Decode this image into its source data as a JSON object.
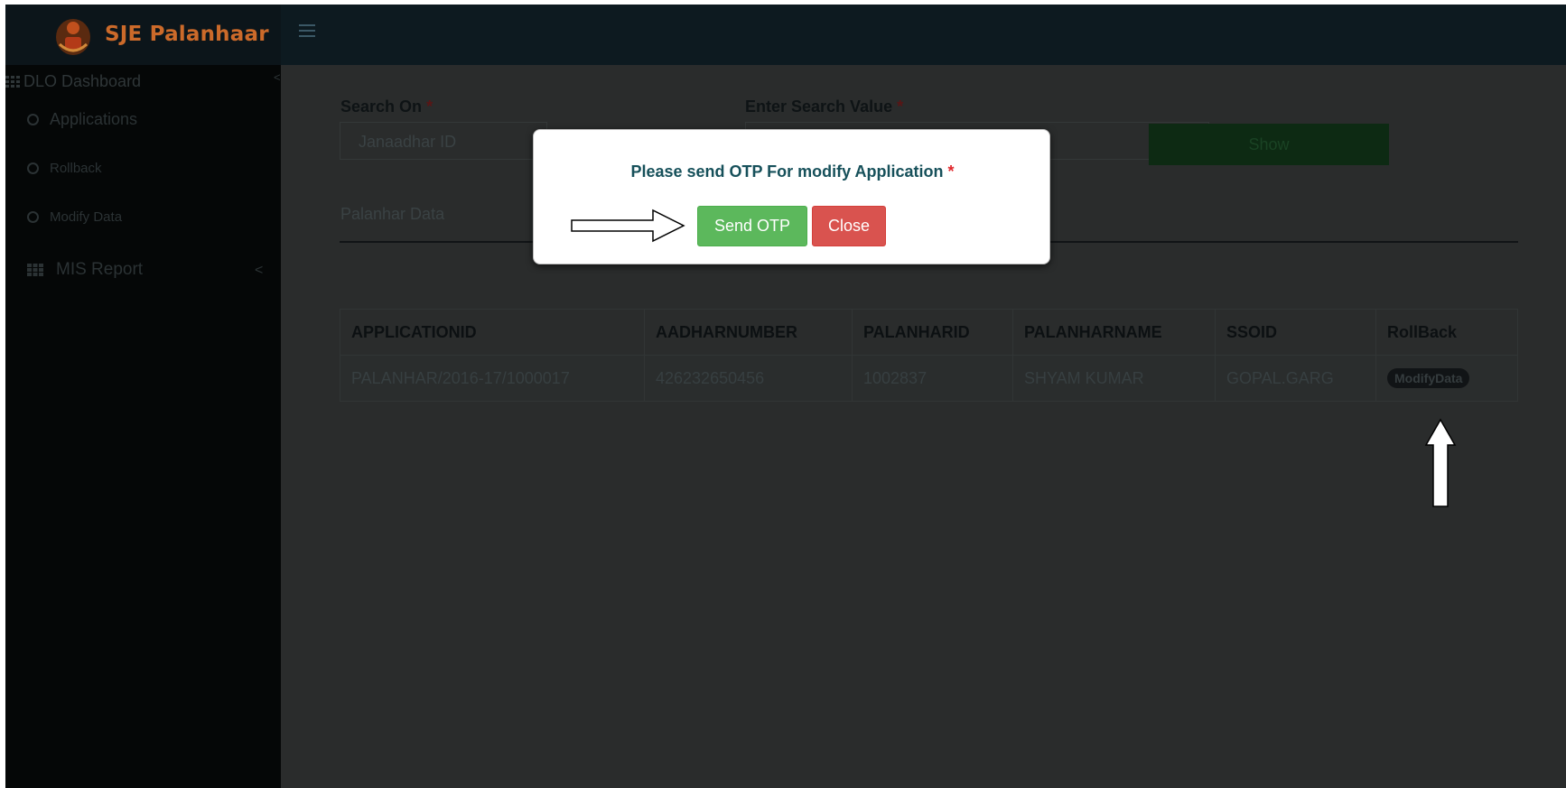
{
  "header": {
    "brand": "SJE Palanhaar",
    "logo_icon": "rajasthan-emblem-icon",
    "menu_icon": "hamburger-icon"
  },
  "sidebar": {
    "dashboard_label": "DLO Dashboard",
    "items": [
      {
        "label": "Applications",
        "icon": "circle-icon"
      },
      {
        "label": "Rollback",
        "icon": "circle-icon"
      },
      {
        "label": "Modify Data",
        "icon": "circle-icon"
      }
    ],
    "mis_label": "MIS Report",
    "collapse_glyph": "<",
    "mis_caret": "<"
  },
  "search": {
    "search_on_label": "Search On",
    "search_on_value": "Janaadhar ID",
    "search_value_label": "Enter Search Value",
    "required_mark": "*",
    "show_label": "Show"
  },
  "tab": {
    "label": "Palanhar Data"
  },
  "table": {
    "headers": [
      "APPLICATIONID",
      "AADHARNUMBER",
      "PALANHARID",
      "PALANHARNAME",
      "SSOID",
      "RollBack"
    ],
    "rows": [
      {
        "applicationid": "PALANHAR/2016-17/1000017",
        "aadharnumber": "426232650456",
        "palanharid": "1002837",
        "palanharname": "SHYAM KUMAR",
        "ssoid": "GOPAL.GARG",
        "action": "ModifyData"
      }
    ]
  },
  "modal": {
    "title": "Please send OTP For modify Application",
    "required_mark": "*",
    "send_label": "Send OTP",
    "close_label": "Close"
  },
  "colors": {
    "send_green": "#5cb85c",
    "close_red": "#d9534f",
    "title_teal": "#16505a",
    "brand_orange": "#cc6a2a"
  }
}
